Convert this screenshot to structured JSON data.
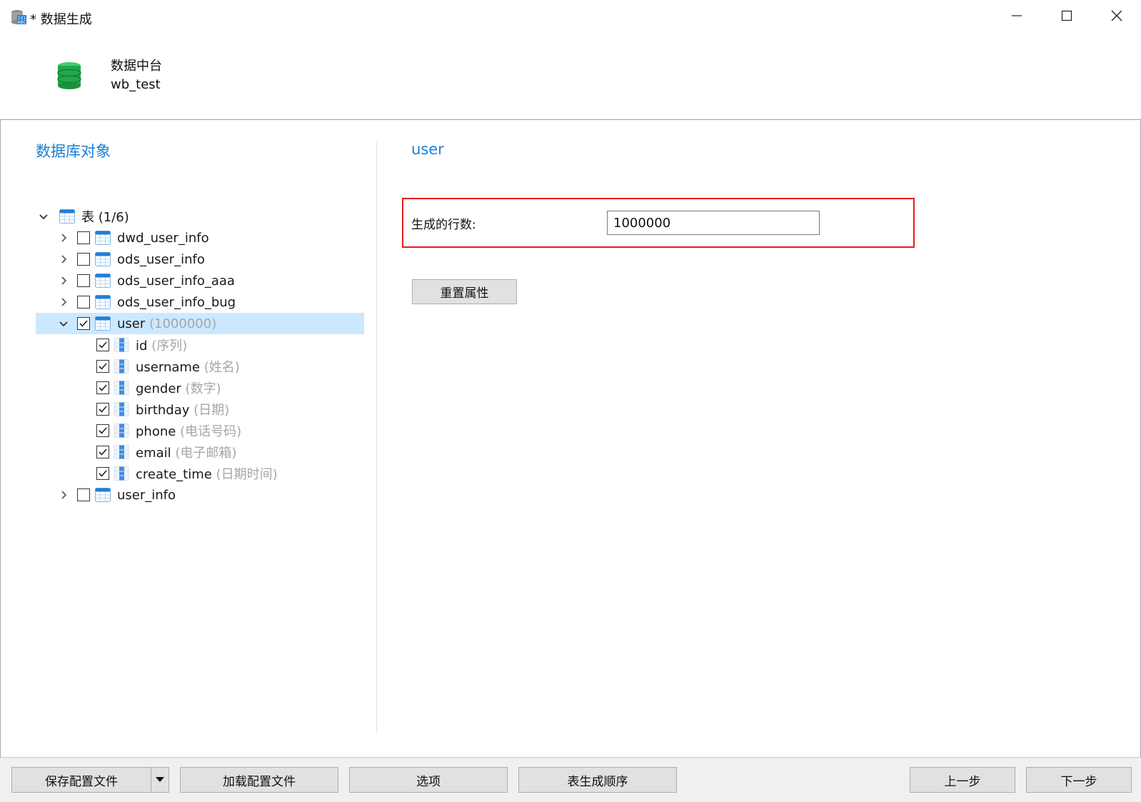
{
  "window": {
    "title": "* 数据生成",
    "app_icon": "data-generation-icon",
    "controls": [
      "minimize-icon",
      "maximize-icon",
      "close-icon"
    ]
  },
  "header": {
    "connection_name": "数据中台",
    "database_name": "wb_test",
    "icon": "database-icon",
    "icon_color": "#2bb24c"
  },
  "left_panel": {
    "title": "数据库对象",
    "tree": {
      "root": {
        "label": "表",
        "count": "(1/6)",
        "expanded": true
      },
      "tables": [
        {
          "name": "dwd_user_info",
          "checked": false,
          "expanded": false
        },
        {
          "name": "ods_user_info",
          "checked": false,
          "expanded": false
        },
        {
          "name": "ods_user_info_aaa",
          "checked": false,
          "expanded": false
        },
        {
          "name": "ods_user_info_bug",
          "checked": false,
          "expanded": false
        },
        {
          "name": "user",
          "hint": "(1000000)",
          "checked": true,
          "expanded": true,
          "selected": true
        },
        {
          "name": "user_info",
          "checked": false,
          "expanded": false
        }
      ],
      "columns": [
        {
          "name": "id",
          "hint": "(序列)",
          "checked": true
        },
        {
          "name": "username",
          "hint": "(姓名)",
          "checked": true
        },
        {
          "name": "gender",
          "hint": "(数字)",
          "checked": true
        },
        {
          "name": "birthday",
          "hint": "(日期)",
          "checked": true
        },
        {
          "name": "phone",
          "hint": "(电话号码)",
          "checked": true
        },
        {
          "name": "email",
          "hint": "(电子邮箱)",
          "checked": true
        },
        {
          "name": "create_time",
          "hint": "(日期时间)",
          "checked": true
        }
      ]
    }
  },
  "right_panel": {
    "title": "user",
    "rows_label": "生成的行数:",
    "rows_value": "1000000",
    "reset_button": "重置属性",
    "highlight_color": "#e81c1c"
  },
  "footer": {
    "save_config": "保存配置文件",
    "load_config": "加载配置文件",
    "options": "选项",
    "table_order": "表生成顺序",
    "prev": "上一步",
    "next": "下一步"
  },
  "colors": {
    "accent": "#1a7fd4",
    "selection": "#cce8ff",
    "hint_text": "#a6a6a6"
  }
}
